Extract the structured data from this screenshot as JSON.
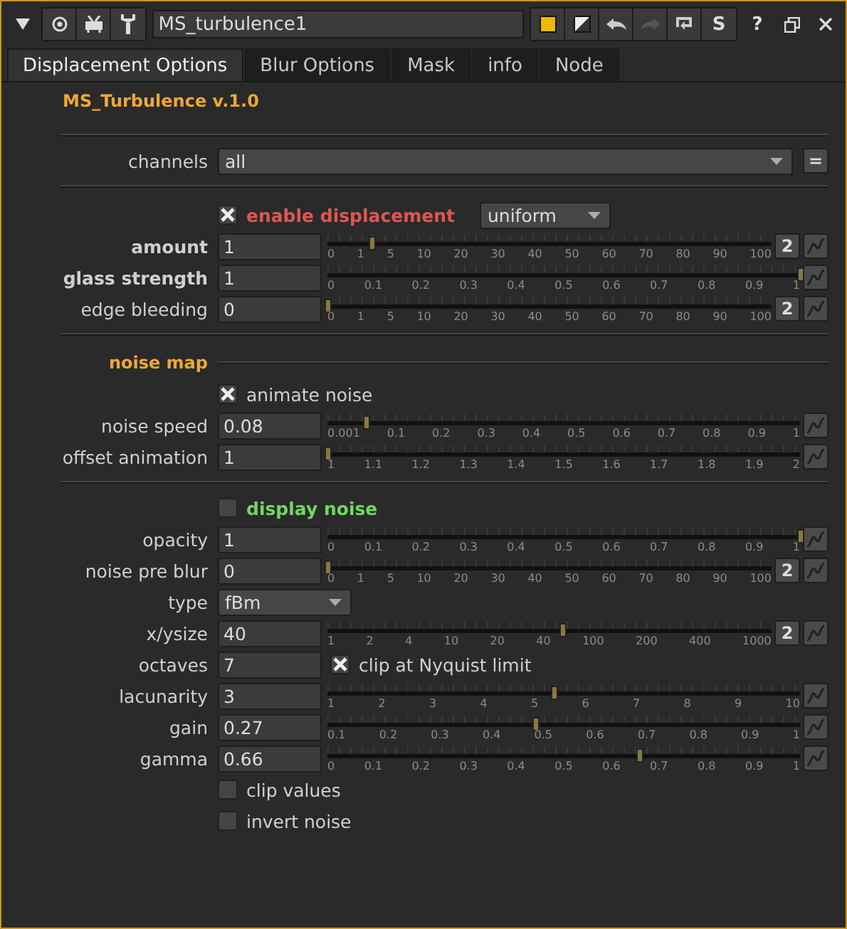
{
  "header": {
    "tools": [
      {
        "kind": "collapse"
      },
      {
        "kind": "circle"
      },
      {
        "kind": "bug"
      },
      {
        "kind": "wrench"
      }
    ],
    "name": "MS_turbulence1",
    "actions": [
      {
        "kind": "color"
      },
      {
        "kind": "mixed"
      },
      {
        "kind": "undo",
        "disabled": false
      },
      {
        "kind": "redo",
        "disabled": true
      },
      {
        "kind": "revert"
      },
      {
        "kind": "text",
        "label": "S"
      }
    ],
    "help": "?",
    "window_buttons": [
      {
        "kind": "float"
      },
      {
        "kind": "close"
      }
    ]
  },
  "tabs": [
    {
      "label": "Displacement Options",
      "selected": true
    },
    {
      "label": "Blur Options",
      "selected": false
    },
    {
      "label": "Mask",
      "selected": false
    },
    {
      "label": "info",
      "selected": false
    },
    {
      "label": "Node",
      "selected": false
    }
  ],
  "title": "MS_Turbulence v.1.0",
  "rows": [
    {
      "kind": "separator"
    },
    {
      "kind": "channels",
      "label": "channels",
      "value": "all",
      "button": "="
    },
    {
      "kind": "separator"
    },
    {
      "kind": "check-menu",
      "checked": true,
      "label": "enable displacement",
      "color": "#e05555",
      "menu": "uniform"
    },
    {
      "kind": "slider",
      "label": "amount",
      "bold": true,
      "value": "1",
      "level": 0.1,
      "split": "2",
      "ticks": [
        "0",
        "1",
        "5",
        "10",
        "20",
        "30",
        "40",
        "50",
        "60",
        "70",
        "80",
        "90",
        "100"
      ]
    },
    {
      "kind": "slider",
      "label": "glass strength",
      "bold": true,
      "value": "1",
      "level": 1,
      "ticks": [
        "0",
        "0.1",
        "0.2",
        "0.3",
        "0.4",
        "0.5",
        "0.6",
        "0.7",
        "0.8",
        "0.9",
        "1"
      ]
    },
    {
      "kind": "slider",
      "label": "edge bleeding",
      "bold": false,
      "value": "0",
      "level": 0,
      "split": "2",
      "ticks": [
        "0",
        "1",
        "5",
        "10",
        "20",
        "30",
        "40",
        "50",
        "60",
        "70",
        "80",
        "90",
        "100"
      ]
    },
    {
      "kind": "separator"
    },
    {
      "kind": "heading",
      "label": "noise map",
      "color": "#f0a830"
    },
    {
      "kind": "checkbox",
      "checked": true,
      "label": "animate noise",
      "bold": false
    },
    {
      "kind": "slider",
      "label": "noise speed",
      "bold": false,
      "value": "0.08",
      "level": 0.08,
      "ticks": [
        "0.001",
        "0.1",
        "0.2",
        "0.3",
        "0.4",
        "0.5",
        "0.6",
        "0.7",
        "0.8",
        "0.9",
        "1"
      ]
    },
    {
      "kind": "slider",
      "label": "offset animation",
      "bold": false,
      "value": "1",
      "level": 0,
      "ticks": [
        "1",
        "1.1",
        "1.2",
        "1.3",
        "1.4",
        "1.5",
        "1.6",
        "1.7",
        "1.8",
        "1.9",
        "2"
      ]
    },
    {
      "kind": "separator"
    },
    {
      "kind": "checkbox",
      "checked": false,
      "label": "display noise",
      "bold": true,
      "color": "#70d860"
    },
    {
      "kind": "slider",
      "label": "opacity",
      "bold": false,
      "value": "1",
      "level": 1,
      "ticks": [
        "0",
        "0.1",
        "0.2",
        "0.3",
        "0.4",
        "0.5",
        "0.6",
        "0.7",
        "0.8",
        "0.9",
        "1"
      ]
    },
    {
      "kind": "slider",
      "label": "noise pre blur",
      "bold": false,
      "value": "0",
      "level": 0,
      "split": "2",
      "ticks": [
        "0",
        "1",
        "5",
        "10",
        "20",
        "30",
        "40",
        "50",
        "60",
        "70",
        "80",
        "90",
        "100"
      ]
    },
    {
      "kind": "menu",
      "label": "type",
      "value": "fBm"
    },
    {
      "kind": "slider",
      "label": "x/ysize",
      "bold": false,
      "value": "40",
      "level": 0.53,
      "split": "2",
      "ticks": [
        "1",
        "2",
        "4",
        "10",
        "20",
        "40",
        "100",
        "200",
        "400",
        "1000"
      ]
    },
    {
      "kind": "number-check",
      "label": "octaves",
      "value": "7",
      "checked": true,
      "check_label": "clip at Nyquist limit"
    },
    {
      "kind": "slider",
      "label": "lacunarity",
      "bold": false,
      "value": "3",
      "level": 0.48,
      "ticks": [
        "1",
        "2",
        "3",
        "4",
        "5",
        "6",
        "7",
        "8",
        "9",
        "10"
      ]
    },
    {
      "kind": "slider",
      "label": "gain",
      "bold": false,
      "value": "0.27",
      "level": 0.44,
      "ticks": [
        "0.1",
        "0.2",
        "0.3",
        "0.4",
        "0.5",
        "0.6",
        "0.7",
        "0.8",
        "0.9",
        "1"
      ]
    },
    {
      "kind": "slider",
      "label": "gamma",
      "bold": false,
      "value": "0.66",
      "level": 0.66,
      "ticks": [
        "0",
        "0.1",
        "0.2",
        "0.3",
        "0.4",
        "0.5",
        "0.6",
        "0.7",
        "0.8",
        "0.9",
        "1"
      ]
    },
    {
      "kind": "checkbox",
      "checked": false,
      "label": "clip values",
      "bold": false
    },
    {
      "kind": "checkbox",
      "checked": false,
      "label": "invert noise",
      "bold": false
    }
  ]
}
